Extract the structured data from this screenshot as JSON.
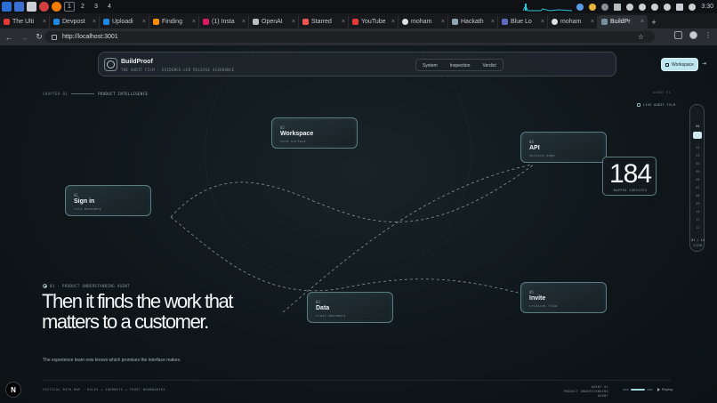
{
  "os": {
    "workspaces": [
      "1",
      "2",
      "3",
      "4"
    ],
    "active_workspace": "1",
    "clock": "3:30"
  },
  "browser": {
    "tabs": [
      {
        "label": "The Ulti",
        "color": "#e53935"
      },
      {
        "label": "Devpost",
        "color": "#1e88e5"
      },
      {
        "label": "Uploadi",
        "color": "#1e88e5"
      },
      {
        "label": "Finding",
        "color": "#fb8c00"
      },
      {
        "label": "(1) Insta",
        "color": "#d81b60"
      },
      {
        "label": "OpenAI",
        "color": "#bdbdbd"
      },
      {
        "label": "Starred",
        "color": "#ef5350"
      },
      {
        "label": "YouTube",
        "color": "#e53935"
      },
      {
        "label": "moham",
        "color": "#e0e0e0"
      },
      {
        "label": "Hackath",
        "color": "#90a4ae"
      },
      {
        "label": "Blue Lo",
        "color": "#5c6bc0"
      },
      {
        "label": "moham",
        "color": "#e0e0e0"
      },
      {
        "label": "BuildPr",
        "color": "#78909c",
        "active": true
      }
    ],
    "url": "http://localhost:3001"
  },
  "app": {
    "brand": {
      "name": "BuildProof",
      "subtitle": "THE AUDIT FILM · EVIDENCE-LED RELEASE ASSURANCE"
    },
    "nav": [
      "System",
      "Inspection",
      "Verdict"
    ],
    "workspace_button": "Workspace",
    "exit_glyph": "⇥",
    "chapter": {
      "label": "CHAPTER 01",
      "title": "PRODUCT INTELLIGENCE"
    },
    "agent_top": "AGENT 01",
    "live_audit": "LIVE AUDIT FILM",
    "nodes": [
      {
        "id": "workspace",
        "num": "02",
        "name": "Workspace",
        "sub": "core surface"
      },
      {
        "id": "api",
        "num": "04",
        "name": "API",
        "sub": "service edge"
      },
      {
        "id": "sign-in",
        "num": "01",
        "name": "Sign in",
        "sub": "role boundary"
      },
      {
        "id": "data",
        "num": "03",
        "name": "Data",
        "sub": "trust boundary"
      },
      {
        "id": "invite",
        "num": "05",
        "name": "Invite",
        "sub": "critical flow"
      }
    ],
    "counter": {
      "value": "184",
      "label": "MAPPED SURFACES"
    },
    "rail": {
      "top": "01",
      "items": [
        "02",
        "03",
        "04",
        "05",
        "06",
        "07",
        "08",
        "09",
        "10",
        "11",
        "12"
      ],
      "footer": "01 / 14",
      "footer2": "SCENE"
    },
    "overline": "01 · PRODUCT UNDERSTANDING AGENT",
    "headline": "Then it finds the work that matters to a customer.",
    "lede": "The experience team now knows which promises the interface makes.",
    "footer": {
      "left": "CRITICAL PATH MAP · ROLES + JOURNEYS + TRUST BOUNDARIES",
      "agent_line1": "AGENT 01",
      "agent_line2": "PRODUCT UNDERSTANDING AGENT",
      "replay": "Replay"
    },
    "badge": "N"
  }
}
